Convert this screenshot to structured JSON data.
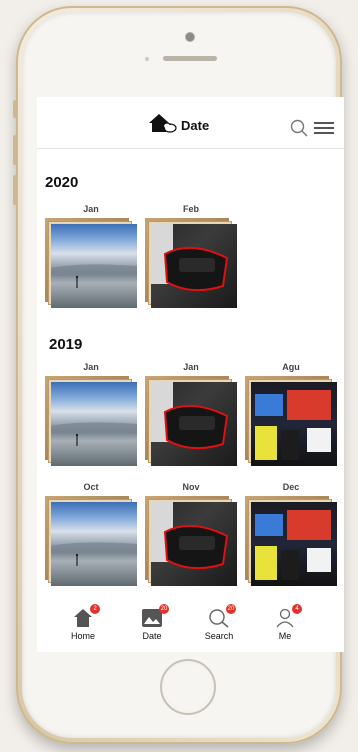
{
  "header": {
    "title": "Date",
    "search_icon": "search-icon",
    "menu_icon": "hamburger-menu-icon"
  },
  "sections": [
    {
      "year": "2020",
      "albums": [
        {
          "label": "Jan",
          "image": "sea-sunset-photo"
        },
        {
          "label": "Feb",
          "image": "red-car-photo"
        }
      ]
    },
    {
      "year": "2019",
      "albums": [
        {
          "label": "Jan",
          "image": "sea-sunset-photo"
        },
        {
          "label": "Jan",
          "image": "red-car-photo"
        },
        {
          "label": "Agu",
          "image": "exhibition-photo"
        },
        {
          "label": "Oct",
          "image": "sea-sunset-photo"
        },
        {
          "label": "Nov",
          "image": "red-car-photo"
        },
        {
          "label": "Dec",
          "image": "exhibition-photo"
        }
      ]
    }
  ],
  "tabbar": {
    "home": {
      "label": "Home",
      "badge": "2"
    },
    "date": {
      "label": "Date",
      "badge": "20"
    },
    "search": {
      "label": "Search",
      "badge": "20"
    },
    "me": {
      "label": "Me",
      "badge": "4"
    }
  },
  "colors": {
    "badge": "#e4322b",
    "icon": "#555555"
  }
}
